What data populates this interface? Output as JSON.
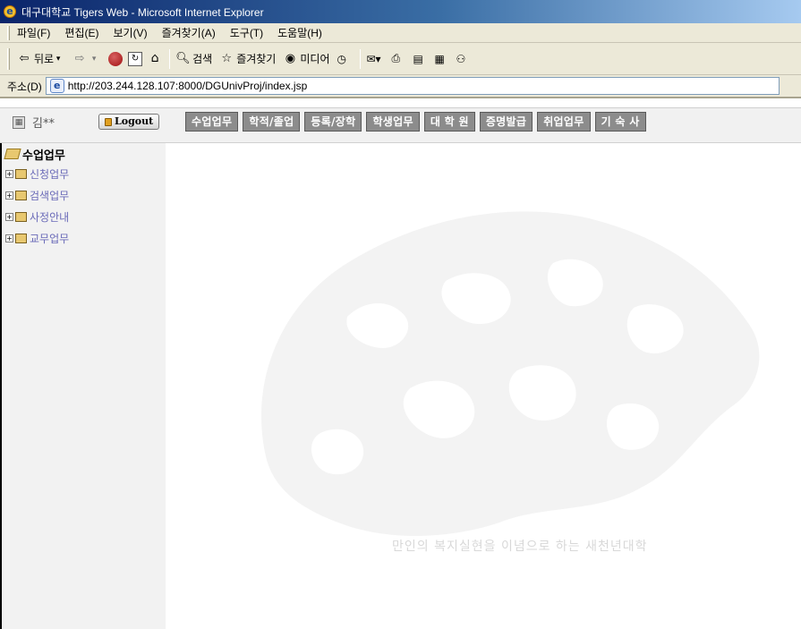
{
  "window": {
    "title": "대구대학교 Tigers Web - Microsoft Internet Explorer"
  },
  "menu": {
    "items": [
      "파일(F)",
      "편집(E)",
      "보기(V)",
      "즐겨찾기(A)",
      "도구(T)",
      "도움말(H)"
    ]
  },
  "toolbar": {
    "back_label": "뒤로",
    "search_label": "검색",
    "favorites_label": "즐겨찾기",
    "media_label": "미디어"
  },
  "address": {
    "label": "주소(D)",
    "url": "http://203.244.128.107:8000/DGUnivProj/index.jsp"
  },
  "header": {
    "user_name": "김**",
    "logout_label": "Logout",
    "nav": [
      "수업업무",
      "학적/졸업",
      "등록/장학",
      "학생업무",
      "대 학 원",
      "증명발급",
      "취업업무",
      "기 숙 사"
    ]
  },
  "sidebar": {
    "root_label": "수업업무",
    "items": [
      {
        "label": "신청업무"
      },
      {
        "label": "검색업무"
      },
      {
        "label": "사정안내"
      },
      {
        "label": "교무업무"
      }
    ]
  },
  "main": {
    "slogan": "만인의 복지실현을 이념으로 하는 새천년대학"
  }
}
